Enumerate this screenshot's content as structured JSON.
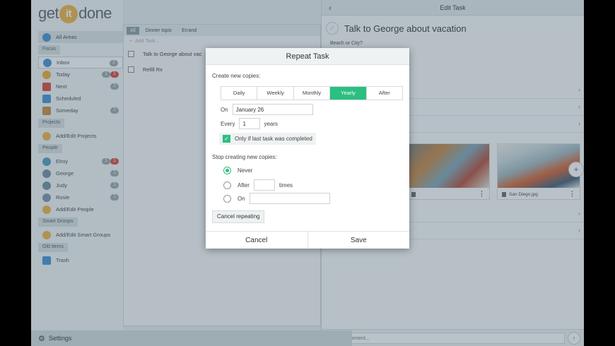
{
  "app": {
    "logo": {
      "pre": "get",
      "mid": "it",
      "post": "done"
    }
  },
  "sidebar": {
    "all_areas": "All Areas",
    "sections": {
      "focus": "Focus",
      "projects": "Projects",
      "people": "People",
      "smart_groups": "Smart Groups",
      "old_items": "Old Items"
    },
    "focus_items": [
      {
        "label": "Inbox",
        "count": "2",
        "icon_color": "#3f8fd6",
        "icon": "inbox-icon"
      },
      {
        "label": "Today",
        "count": "1",
        "count2": "1",
        "icon_color": "#f0a830",
        "icon": "star-icon"
      },
      {
        "label": "Next",
        "count": "2",
        "icon_color": "#d9463b",
        "icon": "next-icon"
      },
      {
        "label": "Scheduled",
        "icon_color": "#3f8fd6",
        "icon": "calendar-icon"
      },
      {
        "label": "Someday",
        "count": "2",
        "icon_color": "#c78a3b",
        "icon": "folder-icon"
      }
    ],
    "projects_items": [
      {
        "label": "Add/Edit Projects",
        "icon": "add-icon"
      }
    ],
    "people_items": [
      {
        "label": "Elroy",
        "count": "1",
        "count2": "1",
        "icon_color": "#4d9ac0"
      },
      {
        "label": "George",
        "count": "1",
        "icon_color": "#6a8fa0"
      },
      {
        "label": "Judy",
        "count": "1",
        "icon_color": "#6a8fa0"
      },
      {
        "label": "Rosie",
        "count": "1",
        "icon_color": "#7a8fa8"
      },
      {
        "label": "Add/Edit People",
        "icon_color": "#f0b23e"
      }
    ],
    "smart_items": [
      {
        "label": "Add/Edit Smart Groups"
      }
    ],
    "old_items": [
      {
        "label": "Trash"
      }
    ],
    "settings_label": "Settings"
  },
  "tasklist": {
    "tabs": [
      "All",
      "Dinner topic",
      "Errand"
    ],
    "add_placeholder": "Add Task...",
    "tasks": [
      "Talk to George about vac",
      "Refill Rx"
    ]
  },
  "edit": {
    "header": "Edit Task",
    "back": "‹",
    "title": "Talk to George about vacation",
    "note": "Beach or City?",
    "photo_caption": "San Diego.jpg",
    "comment_placeholder": "Write a comment..."
  },
  "dialog": {
    "title": "Repeat Task",
    "create_label": "Create new copies:",
    "frequency_options": [
      "Daily",
      "Weekly",
      "Monthly",
      "Yearly",
      "After"
    ],
    "selected_frequency": "Yearly",
    "on_label": "On",
    "on_value": "January 26",
    "every_label": "Every",
    "every_value": "1",
    "every_unit": "years",
    "only_if_label": "Only if last task was completed",
    "only_if_checked": true,
    "stop_label": "Stop creating new copies:",
    "stop_options": {
      "never": "Never",
      "after": "After",
      "after_unit": "times",
      "on": "On"
    },
    "stop_selected": "never",
    "cancel_repeating": "Cancel repeating",
    "cancel": "Cancel",
    "save": "Save"
  },
  "colors": {
    "accent_green": "#2bbf80",
    "overlay": "#465f6e"
  }
}
